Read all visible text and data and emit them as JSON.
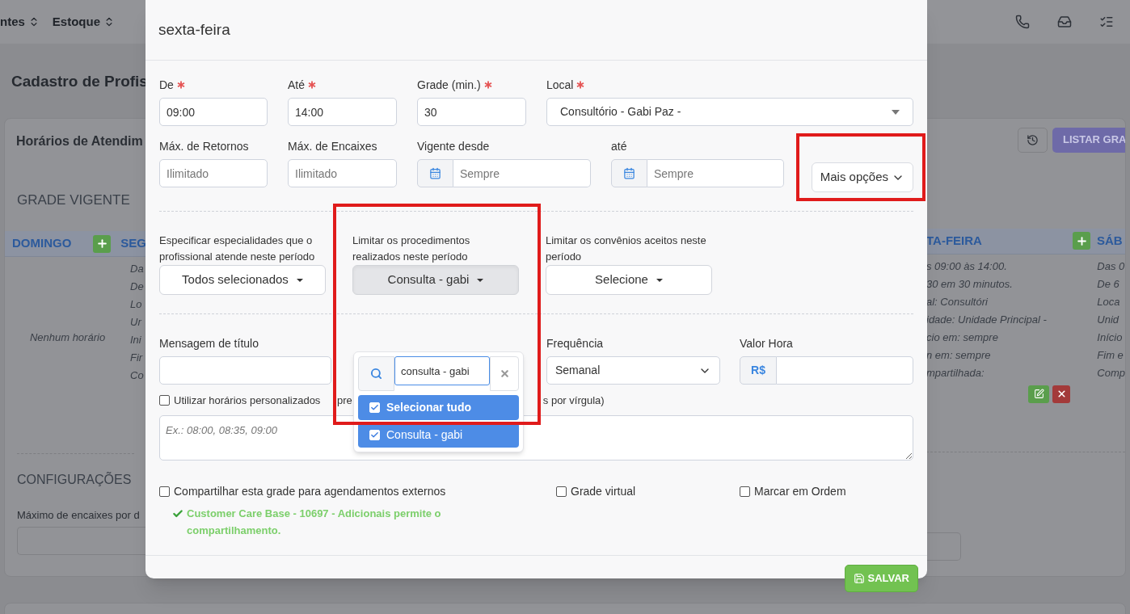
{
  "background": {
    "nav_left": [
      "ntes",
      "Estoque"
    ],
    "page_title": "Cadastro de Profis",
    "card_title": "Horários de Atendim",
    "list_button": "LISTAR GRA",
    "section_title": "GRADE VIGENTE",
    "left_days": [
      {
        "name": "DOMINGO",
        "empty_text": "Nenhum horário"
      },
      {
        "name": "SEG",
        "lines": [
          "Da",
          "De",
          "Lo",
          "Ur",
          "Ini",
          "Fir",
          "Co"
        ]
      }
    ],
    "right_days": [
      {
        "name": "TA-FEIRA",
        "lines": [
          "s 09:00 às 14:00.",
          "30 em 30 minutos.",
          "al: Consultóri",
          "idade: Unidade Principal -",
          "cio em: sempre",
          "n em: sempre",
          "mpartilhada:"
        ]
      },
      {
        "name": "SÁB",
        "lines": [
          "Das 0",
          "De 6",
          "Loca",
          "Unid",
          "Início",
          "Fim e",
          "Comp"
        ]
      }
    ],
    "config_title": "CONFIGURAÇÕES",
    "config_label": "Máximo de encaixes por d"
  },
  "modal": {
    "title": "sexta-feira",
    "row1": [
      {
        "label": "De",
        "required": true,
        "value": "09:00"
      },
      {
        "label": "Até",
        "required": true,
        "value": "14:00"
      },
      {
        "label": "Grade (min.)",
        "required": true,
        "value": "30"
      },
      {
        "label": "Local",
        "required": true,
        "value": "Consultório - Gabi Paz -",
        "kind": "select"
      }
    ],
    "row2": [
      {
        "label": "Máx. de Retornos",
        "placeholder": "Ilimitado"
      },
      {
        "label": "Máx. de Encaixes",
        "placeholder": "Ilimitado"
      },
      {
        "label": "Vigente desde",
        "placeholder": "Sempre",
        "kind": "date"
      },
      {
        "label": "até",
        "placeholder": "Sempre",
        "kind": "date"
      }
    ],
    "more_button": "Mais opções",
    "multiselects": [
      {
        "label": "Especificar especialidades que o profissional atende neste período",
        "value": "Todos selecionados",
        "open": false
      },
      {
        "label": "Limitar os procedimentos realizados neste período",
        "value": "Consulta - gabi",
        "open": true
      },
      {
        "label": "Limitar os convênios aceitos neste período",
        "value": "Selecione",
        "open": false
      }
    ],
    "dropdown": {
      "search_value": "consulta - gabi",
      "options": [
        {
          "label": "Selecionar tudo",
          "kind": "all",
          "checked": true,
          "selected": true
        },
        {
          "label": "Consulta - gabi",
          "kind": "item",
          "checked": true,
          "selected": true
        }
      ]
    },
    "title_message": {
      "label": "Mensagem de título"
    },
    "frequency": {
      "label": "Frequência",
      "value": "Semanal"
    },
    "hourly_value": {
      "label": "Valor Hora",
      "prefix": "R$"
    },
    "custom_times": {
      "checked": false,
      "label_start": "Utilizar horários personalizados",
      "label_mid": "pre",
      "label_end": "s por vírgula)",
      "placeholder": "Ex.: 08:00, 08:35, 09:00"
    },
    "options": [
      {
        "label": "Compartilhar esta grade para agendamentos externos",
        "checked": false
      },
      {
        "label": "Grade virtual",
        "checked": false
      },
      {
        "label": "Marcar em Ordem",
        "checked": false
      }
    ],
    "share_note": "Customer Care Base - 10697 - Adicionais permite o compartilhamento.",
    "save_button": "SALVAR"
  }
}
